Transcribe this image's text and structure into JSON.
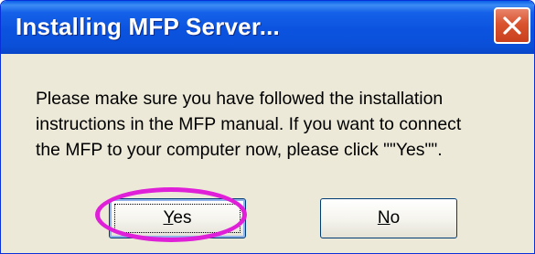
{
  "dialog": {
    "title": "Installing MFP Server...",
    "close_icon": "close-icon",
    "message_lines": [
      "Please make sure you have followed the installation",
      "instructions in the MFP manual. If you want to connect",
      "the MFP to your computer now, please click \"\"Yes\"\"."
    ],
    "buttons": {
      "yes": {
        "mnemonic": "Y",
        "rest": "es"
      },
      "no": {
        "mnemonic": "N",
        "rest": "o"
      }
    },
    "annotation": {
      "shape": "ellipse",
      "color": "#e020d8",
      "target": "yes-button"
    },
    "colors": {
      "titlebar": "#0b53df",
      "close_button": "#d9532f",
      "body": "#ece9d8"
    }
  }
}
